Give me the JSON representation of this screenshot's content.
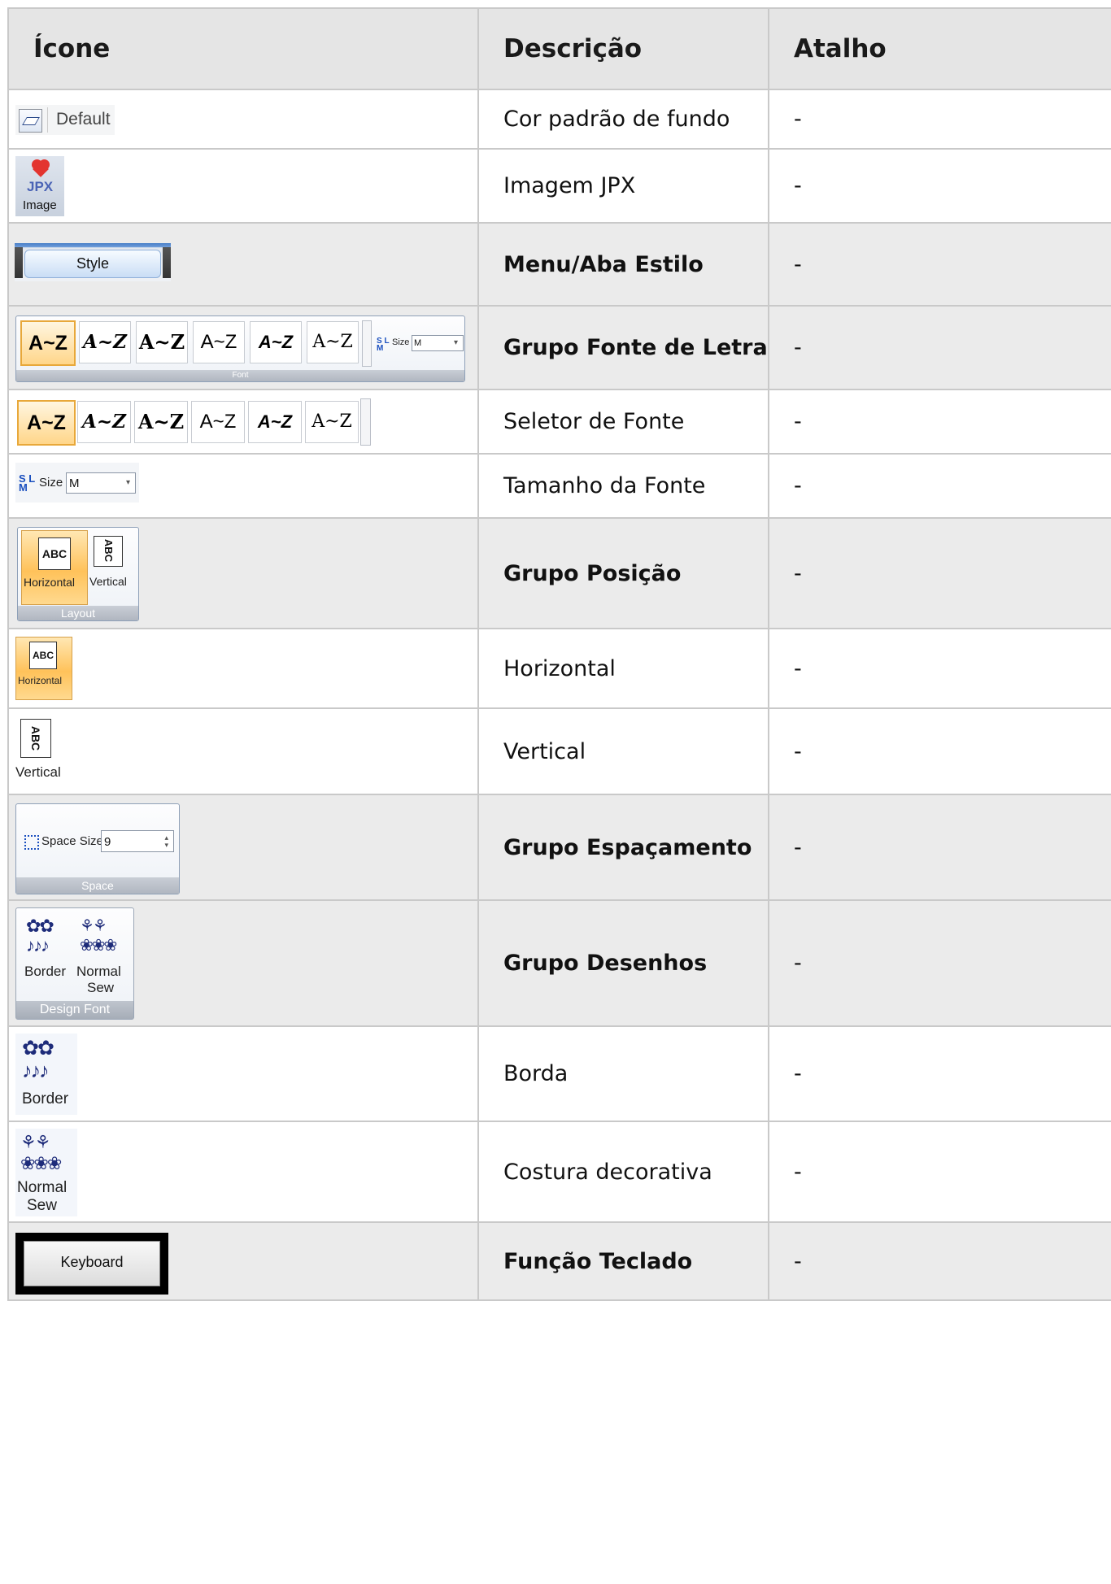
{
  "headers": {
    "icon": "Ícone",
    "description": "Descrição",
    "shortcut": "Atalho"
  },
  "rows": [
    {
      "description": "Cor padrão de fundo",
      "shortcut": "-",
      "bold": false
    },
    {
      "description": "Imagem JPX",
      "shortcut": "-",
      "bold": false
    },
    {
      "description": "Menu/Aba Estilo",
      "shortcut": "-",
      "bold": true
    },
    {
      "description": "Grupo Fonte de Letra",
      "shortcut": "-",
      "bold": true
    },
    {
      "description": "Seletor de Fonte",
      "shortcut": "-",
      "bold": false
    },
    {
      "description": "Tamanho da Fonte",
      "shortcut": "-",
      "bold": false
    },
    {
      "description": "Grupo Posição",
      "shortcut": "-",
      "bold": true
    },
    {
      "description": "Horizontal",
      "shortcut": "-",
      "bold": false
    },
    {
      "description": "Vertical",
      "shortcut": "-",
      "bold": false
    },
    {
      "description": "Grupo Espaçamento",
      "shortcut": "-",
      "bold": true
    },
    {
      "description": "Grupo Desenhos",
      "shortcut": "-",
      "bold": true
    },
    {
      "description": "Borda",
      "shortcut": "-",
      "bold": false
    },
    {
      "description": "Costura decorativa",
      "shortcut": "-",
      "bold": false
    },
    {
      "description": "Função Teclado",
      "shortcut": "-",
      "bold": true
    }
  ],
  "icons": {
    "default_label": "Default",
    "image_label": "Image",
    "image_jpx": "JPX",
    "style_tab": "Style",
    "font_samples": [
      "A~Z",
      "A~Z",
      "A~Z",
      "A~Z",
      "A~Z",
      "A~Z"
    ],
    "font_group_label": "Font",
    "size_label": "Size",
    "size_value": "M",
    "size_icon_top": "S L",
    "size_icon_bottom": "M",
    "abc": "ABC",
    "horizontal_label": "Horizontal",
    "vertical_label": "Vertical",
    "layout_group_label": "Layout",
    "space_size_label": "Space Size",
    "space_size_value": "9",
    "space_group_label": "Space",
    "border_label": "Border",
    "normal_sew_label_1": "Normal",
    "normal_sew_label_2": "Sew",
    "design_font_label": "Design Font",
    "keyboard_label": "Keyboard",
    "colors": {
      "header_bg": "#e5e5e5",
      "row_gray": "#ebebeb",
      "grid": "#c9c9c9",
      "orange": "#ffc25a",
      "ribbon_blue": "#8ea0b8",
      "design_navy": "#1e2c7a"
    }
  }
}
